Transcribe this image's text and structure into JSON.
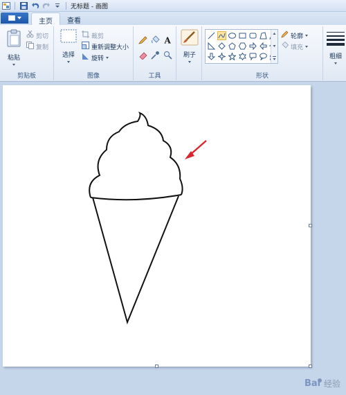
{
  "window": {
    "title": "无标题 - 画图"
  },
  "tabs": [
    {
      "label": "主页",
      "active": true
    },
    {
      "label": "查看",
      "active": false
    }
  ],
  "clipboard": {
    "paste": "粘贴",
    "cut": "剪切",
    "copy": "复制",
    "group_label": "剪贴板"
  },
  "image": {
    "select": "选择",
    "crop": "裁剪",
    "resize": "重新调整大小",
    "rotate": "旋转",
    "group_label": "图像"
  },
  "tools": {
    "group_label": "工具",
    "icons": [
      "pencil-icon",
      "fill-icon",
      "text-icon",
      "eraser-icon",
      "color-picker-icon",
      "magnifier-icon"
    ]
  },
  "brushes": {
    "label": "刷子"
  },
  "shapes": {
    "group_label": "形状",
    "outline": "轮廓",
    "fill": "填充"
  },
  "size": {
    "label": "粗细"
  },
  "watermark": {
    "text": "经验"
  },
  "colors": {
    "accent": "#1d56a8",
    "ribbon": "#eaf0f8",
    "selected_shape": "#fbe3a2",
    "arrow": "#d9252b"
  }
}
